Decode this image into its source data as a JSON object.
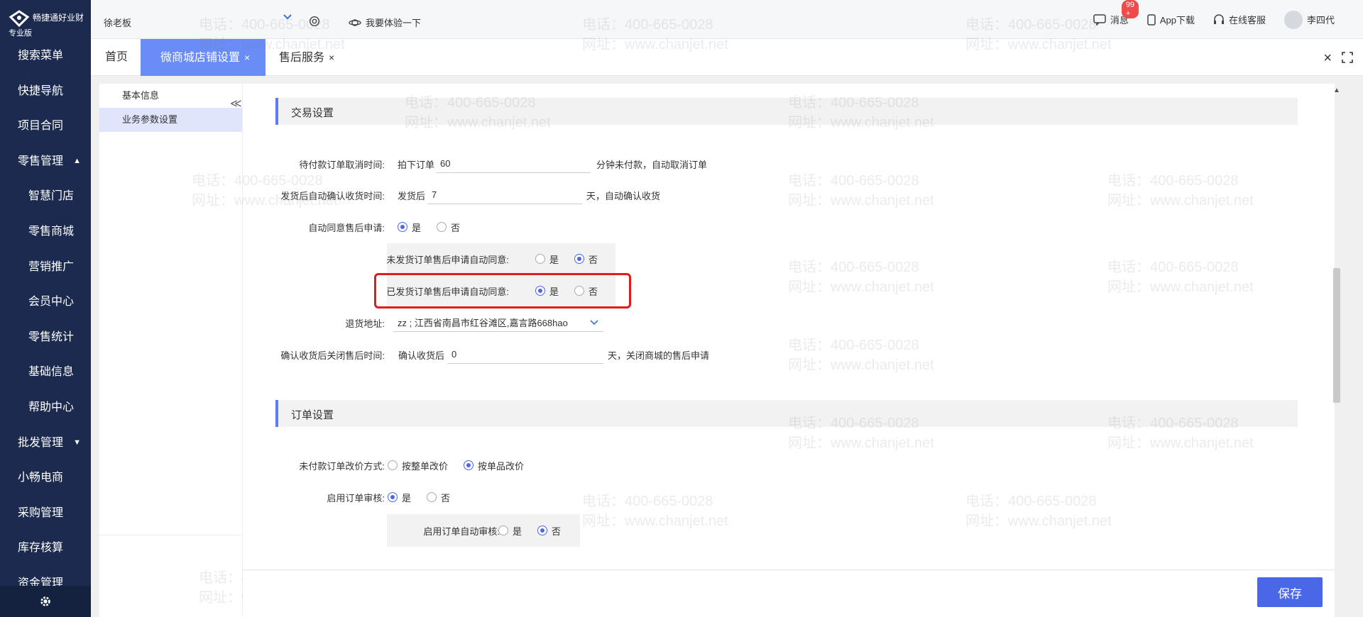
{
  "app": {
    "brand": "畅捷通好业财",
    "edition": "专业版"
  },
  "sidebar": {
    "items": [
      {
        "label": "搜索菜单"
      },
      {
        "label": "快捷导航"
      },
      {
        "label": "项目合同"
      },
      {
        "label": "零售管理",
        "caret": "▲"
      },
      {
        "label": "智慧门店"
      },
      {
        "label": "零售商城"
      },
      {
        "label": "营销推广"
      },
      {
        "label": "会员中心"
      },
      {
        "label": "零售统计"
      },
      {
        "label": "基础信息"
      },
      {
        "label": "帮助中心"
      },
      {
        "label": "批发管理",
        "caret": "▼"
      },
      {
        "label": "小畅电商"
      },
      {
        "label": "采购管理"
      },
      {
        "label": "库存核算"
      },
      {
        "label": "资金管理"
      }
    ]
  },
  "topbar": {
    "company": "徐老板",
    "try_label": "我要体验一下",
    "messages_label": "消息",
    "messages_badge": "99 +",
    "app_download": "App下载",
    "online_service": "在线客服",
    "user": "李四代"
  },
  "tabs": {
    "home": "首页",
    "store_settings": "微商城店铺设置",
    "after_sales": "售后服务",
    "close_mark": "×"
  },
  "tree": {
    "basic_info": "基本信息",
    "business_params": "业务参数设置",
    "collapse": "≪"
  },
  "trade_section": {
    "title": "交易设置",
    "unpaid_cancel": {
      "label": "待付款订单取消时间:",
      "prefix": "拍下订单",
      "value": "60",
      "suffix": "分钟未付款，自动取消订单"
    },
    "auto_confirm": {
      "label": "发货后自动确认收货时间:",
      "prefix": "发货后",
      "value": "7",
      "suffix": "天，自动确认收货"
    },
    "auto_agree": {
      "label": "自动同意售后申请:",
      "yes": "是",
      "no": "否"
    },
    "unshipped_agree": {
      "label": "未发货订单售后申请自动同意:",
      "yes": "是",
      "no": "否"
    },
    "shipped_agree": {
      "label": "已发货订单售后申请自动同意:",
      "yes": "是",
      "no": "否"
    },
    "return_address": {
      "label": "退货地址:",
      "value": "zz ; 江西省南昌市红谷滩区,嘉言路668hao"
    },
    "close_after": {
      "label": "确认收货后关闭售后时间:",
      "prefix": "确认收货后",
      "value": "0",
      "suffix": "天，关闭商城的售后申请"
    }
  },
  "order_section": {
    "title": "订单设置",
    "price_change": {
      "label": "未付款订单改价方式:",
      "opt1": "按整单改价",
      "opt2": "按单品改价"
    },
    "order_audit": {
      "label": "启用订单审核:",
      "yes": "是",
      "no": "否"
    },
    "auto_audit": {
      "label": "启用订单自动审核:",
      "yes": "是",
      "no": "否"
    }
  },
  "save_label": "保存",
  "watermark": {
    "phone": "电话：400-665-0028",
    "site": "网址：www.chanjet.net"
  },
  "colors": {
    "sidebar": "#1b2a4e",
    "accent": "#4a67e8",
    "tab_active": "#6a8cf7",
    "highlight": "#e31b1b"
  }
}
